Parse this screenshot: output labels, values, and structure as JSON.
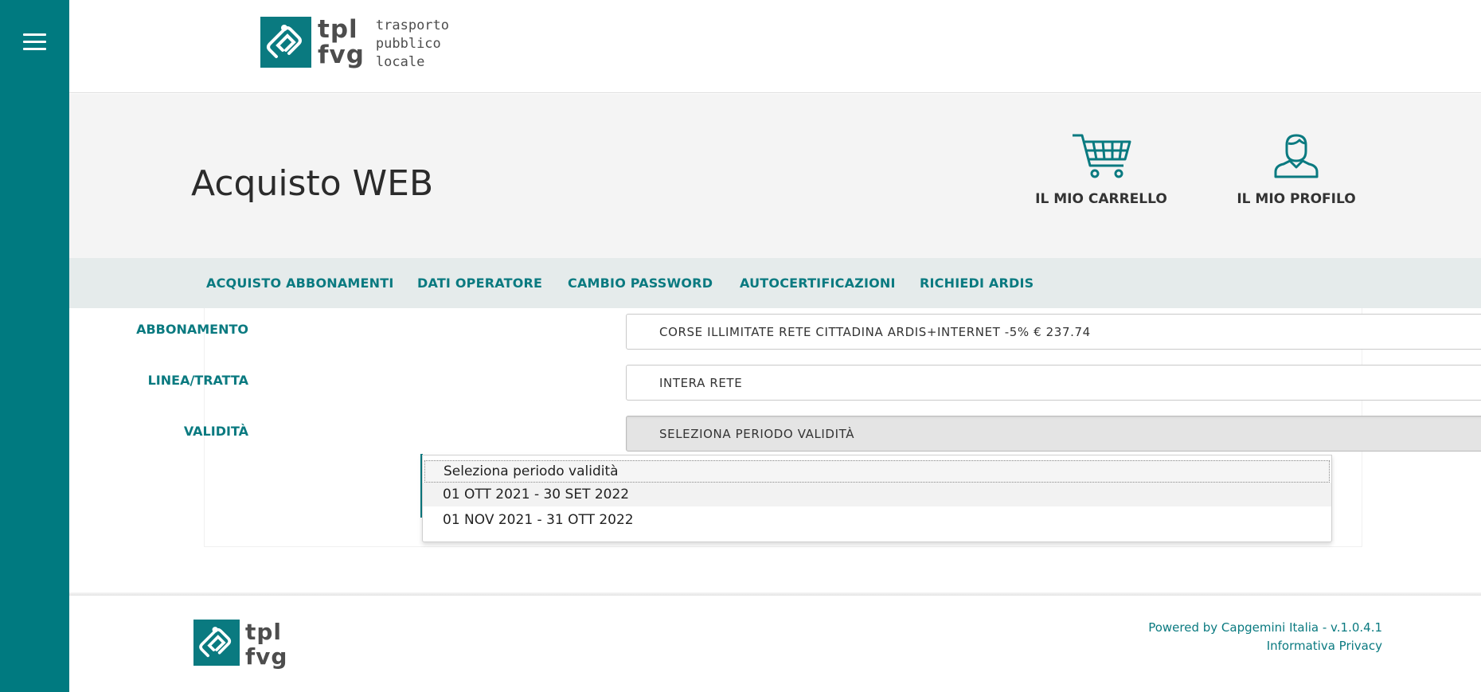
{
  "logo": {
    "brand_top": "tpl",
    "brand_bottom": "fvg",
    "tagline": [
      "trasporto",
      "pubblico",
      "locale"
    ]
  },
  "header": {
    "title": "Acquisto WEB",
    "cart_label": "IL MIO CARRELLO",
    "profile_label": "IL MIO PROFILO"
  },
  "nav": {
    "items": [
      "ACQUISTO ABBONAMENTI",
      "DATI OPERATORE",
      "CAMBIO PASSWORD",
      "AUTOCERTIFICAZIONI",
      "RICHIEDI ARDIS"
    ]
  },
  "form": {
    "abbonamento_label": "ABBONAMENTO",
    "abbonamento_value": "CORSE ILLIMITATE RETE CITTADINA ARDIS+INTERNET -5% € 237.74",
    "linea_label": "LINEA/TRATTA",
    "linea_value": "INTERA RETE",
    "validita_label": "VALIDITÀ",
    "validita_value": "SELEZIONA PERIODO VALIDITÀ",
    "validita_options": [
      "Seleziona periodo validità",
      "01 OTT 2021 - 30 SET 2022",
      "01 NOV 2021 - 31 OTT 2022"
    ]
  },
  "footer": {
    "powered_by": "Powered by Capgemini Italia - v.1.0.4.1",
    "privacy": "Informativa Privacy"
  },
  "colors": {
    "brand_teal": "#007a80",
    "nav_bg": "#e5ebeb",
    "header_bg": "#f4f4f4"
  },
  "icons": [
    "menu-icon",
    "cart-icon",
    "user-icon",
    "chevron-down-icon",
    "logo-mark-icon"
  ]
}
